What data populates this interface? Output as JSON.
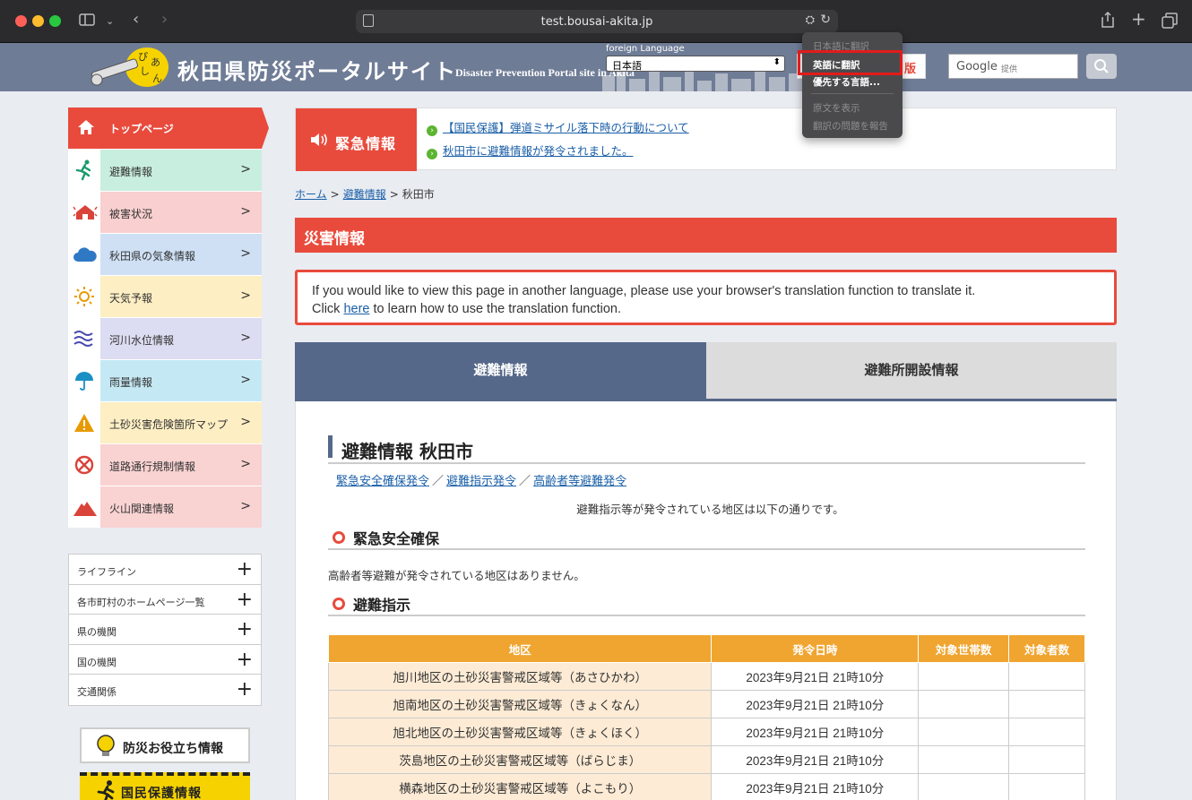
{
  "browser": {
    "url": "test.bousai-akita.jp"
  },
  "header": {
    "logo_title": "秋田県防災ポータルサイト",
    "logo_subtitle": "Disaster Prevention Portal site in Akita",
    "foreign_language_label": "foreign Language",
    "language_selected": "日本語",
    "mobile_label": "版",
    "google_label": "Google",
    "google_sub": "提供"
  },
  "translate_menu": {
    "items": [
      "日本語に翻訳",
      "英語に翻訳",
      "優先する言語...",
      "原文を表示",
      "翻訳の問題を報告"
    ]
  },
  "sidebar": {
    "top_item": "トップページ",
    "items": [
      {
        "label": "避難情報",
        "color": "#c8eedf"
      },
      {
        "label": "被害状況",
        "color": "#f9cfcf"
      },
      {
        "label": "秋田県の気象情報",
        "color": "#cfe0f5"
      },
      {
        "label": "天気予報",
        "color": "#fdeec3"
      },
      {
        "label": "河川水位情報",
        "color": "#dcdcf2"
      },
      {
        "label": "雨量情報",
        "color": "#c5e9f4"
      },
      {
        "label": "土砂災害危険箇所マップ",
        "color": "#fdeec3"
      },
      {
        "label": "道路通行規制情報",
        "color": "#f9d2d2"
      },
      {
        "label": "火山関連情報",
        "color": "#f9d2d2"
      }
    ],
    "accordion": [
      "ライフライン",
      "各市町村のホームページ一覧",
      "県の機関",
      "国の機関",
      "交通関係"
    ],
    "banner1": "防災お役立ち情報",
    "banner2": "国民保護情報"
  },
  "urgent": {
    "heading": "緊急情報",
    "links": [
      "【国民保護】弾道ミサイル落下時の行動について",
      "秋田市に避難情報が発令されました。"
    ]
  },
  "breadcrumb": {
    "home": "ホーム",
    "section": "避難情報",
    "current": "秋田市",
    "sep": ">"
  },
  "main": {
    "section_title": "災害情報",
    "translation_note_line1": "If you would like to view this page in another language, please use your browser's translation function to translate it.",
    "translation_note_pre": "Click ",
    "translation_note_link": "here",
    "translation_note_post": " to learn how to use the translation function.",
    "tabs": [
      "避難情報",
      "避難所開設情報"
    ],
    "panel_title": "避難情報 秋田市",
    "sub_links": [
      "緊急安全確保発令",
      "避難指示発令",
      "高齢者等避難発令"
    ],
    "sub_sep": "／",
    "center_note": "避難指示等が発令されている地区は以下の通りです。",
    "h3_emergency": "緊急安全確保",
    "no_area_text": "高齢者等避難が発令されている地区はありません。",
    "h3_shiji": "避難指示"
  },
  "table": {
    "headers": [
      "地区",
      "発令日時",
      "対象世帯数",
      "対象者数"
    ],
    "rows": [
      {
        "area": "旭川地区の土砂災害警戒区域等（あさひかわ）",
        "datetime": "2023年9月21日 21時10分",
        "households": "",
        "people": ""
      },
      {
        "area": "旭南地区の土砂災害警戒区域等（きょくなん）",
        "datetime": "2023年9月21日 21時10分",
        "households": "",
        "people": ""
      },
      {
        "area": "旭北地区の土砂災害警戒区域等（きょくほく）",
        "datetime": "2023年9月21日 21時10分",
        "households": "",
        "people": ""
      },
      {
        "area": "茨島地区の土砂災害警戒区域等（ばらじま）",
        "datetime": "2023年9月21日 21時10分",
        "households": "",
        "people": ""
      },
      {
        "area": "横森地区の土砂災害警戒区域等（よこもり）",
        "datetime": "2023年9月21日 21時10分",
        "households": "",
        "people": ""
      }
    ]
  },
  "colors": {
    "accent_red": "#e84b3c",
    "tab_blue": "#566889",
    "table_orange": "#f0a530",
    "link_blue": "#1a5fa8"
  }
}
